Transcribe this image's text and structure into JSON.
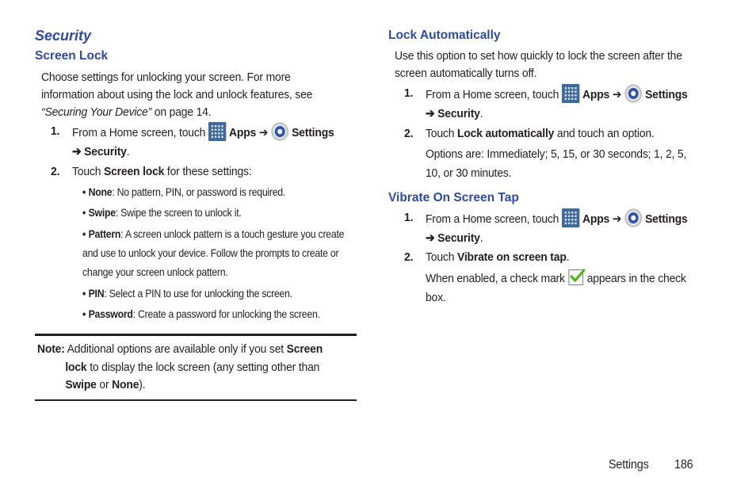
{
  "left": {
    "section_title": "Security",
    "subsection_title": "Screen Lock",
    "intro_line1": "Choose settings for unlocking your screen. For more",
    "intro_line2": "information about using the lock and unlock features, see",
    "intro_link": "“Securing Your Device”",
    "intro_tail": " on page 14.",
    "step1": {
      "num": "1.",
      "pre": "From a Home screen, touch",
      "apps": "Apps",
      "arrow": "➔",
      "settings": "Settings",
      "arrow2": "➔",
      "security": "Security",
      "period": "."
    },
    "step2": {
      "num": "2.",
      "pre": "Touch ",
      "bold": "Screen lock",
      "post": " for these settings:"
    },
    "bullets": [
      {
        "term": "None",
        "lines": [
          ": No pattern, PIN, or password is required."
        ]
      },
      {
        "term": "Swipe",
        "lines": [
          ": Swipe the screen to unlock it."
        ]
      },
      {
        "term": "Pattern",
        "lines": [
          ": A screen unlock pattern is a touch gesture you create",
          "and use to unlock your device. Follow the prompts to create or",
          "change your screen unlock pattern."
        ]
      },
      {
        "term": "PIN",
        "lines": [
          ": Select a PIN to use for unlocking the screen."
        ]
      },
      {
        "term": "Password",
        "lines": [
          ": Create a password for unlocking the screen."
        ]
      }
    ],
    "note": {
      "label": "Note:",
      "l1_pre": " Additional options are available only if you set ",
      "l1_bold": "Screen",
      "l2_bold": "lock",
      "l2_post": " to display the lock screen (any setting other than",
      "l3_bold1": "Swipe",
      "l3_mid": " or ",
      "l3_bold2": "None",
      "l3_post": ")."
    }
  },
  "right": {
    "lock_title": "Lock Automatically",
    "lock_intro1": "Use this option to set how quickly to lock the screen after the",
    "lock_intro2": "screen automatically turns off.",
    "lock_step1": {
      "num": "1.",
      "pre": "From a Home screen, touch",
      "apps": "Apps",
      "arrow": "➔",
      "settings": "Settings",
      "arrow2": "➔",
      "security": "Security",
      "period": "."
    },
    "lock_step2": {
      "num": "2.",
      "pre": "Touch ",
      "bold": "Lock automatically",
      "post": " and touch an option."
    },
    "lock_options1": "Options are: Immediately; 5, 15, or 30 seconds; 1, 2, 5,",
    "lock_options2": "10, or 30 minutes.",
    "vibrate_title": "Vibrate On Screen Tap",
    "vib_step1": {
      "num": "1.",
      "pre": "From a Home screen, touch",
      "apps": "Apps",
      "arrow": "➔",
      "settings": "Settings",
      "arrow2": "➔",
      "security": "Security",
      "period": "."
    },
    "vib_step2": {
      "num": "2.",
      "pre": "Touch ",
      "bold": "Vibrate on screen tap",
      "post": "."
    },
    "vib_enabled1_pre": "When enabled, a check mark",
    "vib_enabled1_post": "appears in the check",
    "vib_enabled2": "box."
  },
  "footer": {
    "section": "Settings",
    "page": "186"
  },
  "icons": {
    "apps": "apps-grid-icon",
    "settings": "settings-gear-icon",
    "check": "checkbox-checked-icon"
  },
  "colors": {
    "heading": "#2e4aa8",
    "text": "#231f20",
    "apps_icon": "#3e6a9c",
    "check": "#5cc21f"
  }
}
